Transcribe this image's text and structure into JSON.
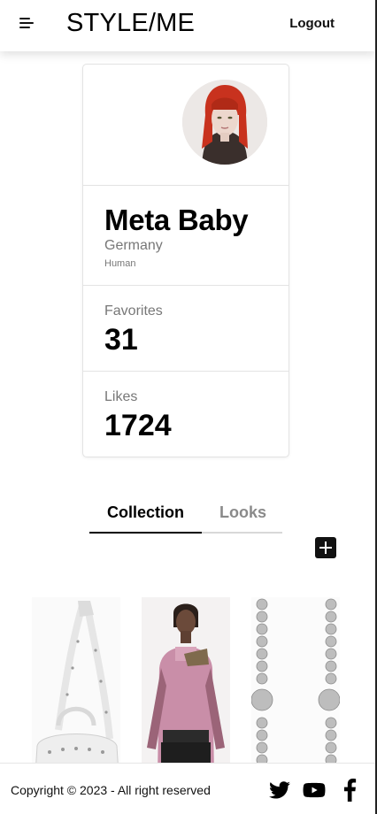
{
  "header": {
    "brand": "STYLE/ME",
    "logout_label": "Logout",
    "menu_icon": "hamburger-menu-icon"
  },
  "profile": {
    "name": "Meta Baby",
    "country": "Germany",
    "species": "Human",
    "favorites_label": "Favorites",
    "favorites_count": "31",
    "likes_label": "Likes",
    "likes_count": "1724"
  },
  "tabs": {
    "items": [
      "Collection",
      "Looks"
    ],
    "active": "Collection"
  },
  "collection": {
    "items": [
      "white studded handbag",
      "pink mesh top",
      "silver ball chain"
    ]
  },
  "footer": {
    "copyright": "Copyright © 2023 - All right reserved",
    "social_icons": [
      "twitter-icon",
      "youtube-icon",
      "facebook-icon"
    ]
  },
  "colors": {
    "accent": "#000000",
    "muted": "#777777",
    "tab_inactive": "#8a8a8a",
    "avatar_hair": "#c8321e"
  }
}
